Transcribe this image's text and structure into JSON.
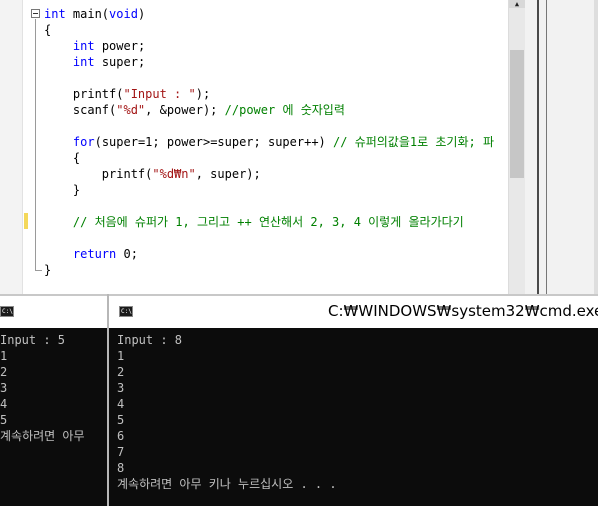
{
  "editor": {
    "lines": [
      [
        {
          "t": "int",
          "c": "kw"
        },
        {
          "t": " main("
        },
        {
          "t": "void",
          "c": "kw"
        },
        {
          "t": ")"
        }
      ],
      [
        {
          "t": "{"
        }
      ],
      [
        {
          "t": "    "
        },
        {
          "t": "int",
          "c": "kw"
        },
        {
          "t": " power;"
        }
      ],
      [
        {
          "t": "    "
        },
        {
          "t": "int",
          "c": "kw"
        },
        {
          "t": " super;"
        }
      ],
      [],
      [
        {
          "t": "    printf("
        },
        {
          "t": "\"Input : \"",
          "c": "str"
        },
        {
          "t": ");"
        }
      ],
      [
        {
          "t": "    scanf("
        },
        {
          "t": "\"%d\"",
          "c": "str"
        },
        {
          "t": ", &power); "
        },
        {
          "t": "//power 에 숫자입력",
          "c": "cm"
        }
      ],
      [],
      [
        {
          "t": "    "
        },
        {
          "t": "for",
          "c": "kw"
        },
        {
          "t": "(super=1; power>=super; super++) "
        },
        {
          "t": "// 슈퍼의값을1로 초기화; 파",
          "c": "cm"
        }
      ],
      [
        {
          "t": "    {"
        }
      ],
      [
        {
          "t": "        printf("
        },
        {
          "t": "\"%d₩n\"",
          "c": "str"
        },
        {
          "t": ", super);"
        }
      ],
      [
        {
          "t": "    }"
        }
      ],
      [],
      [
        {
          "t": "    "
        },
        {
          "t": "// 처음에 슈퍼가 1, 그리고 ++ 연산해서 2, 3, 4 이렇게 올라가다기",
          "c": "cm"
        }
      ],
      [],
      [
        {
          "t": "    "
        },
        {
          "t": "return",
          "c": "kw"
        },
        {
          "t": " 0;"
        }
      ],
      [
        {
          "t": "}"
        }
      ]
    ]
  },
  "console_left": {
    "output": [
      "Input : 5",
      "1",
      "2",
      "3",
      "4",
      "5",
      "계속하려면 아무"
    ]
  },
  "console_right": {
    "title": "C:₩WINDOWS₩system32₩cmd.exe",
    "output": [
      "Input : 8",
      "1",
      "2",
      "3",
      "4",
      "5",
      "6",
      "7",
      "8",
      "계속하려면 아무 키나 누르십시오 . . ."
    ]
  },
  "icons": {
    "console_icon": "cmd-icon",
    "scroll_up": "chevron-up-icon",
    "fold": "collapse-minus-icon"
  },
  "colors": {
    "keyword": "#0000ff",
    "string": "#a31515",
    "comment": "#008000",
    "console_bg": "#0c0c0c",
    "console_text": "#c0c0c0"
  }
}
